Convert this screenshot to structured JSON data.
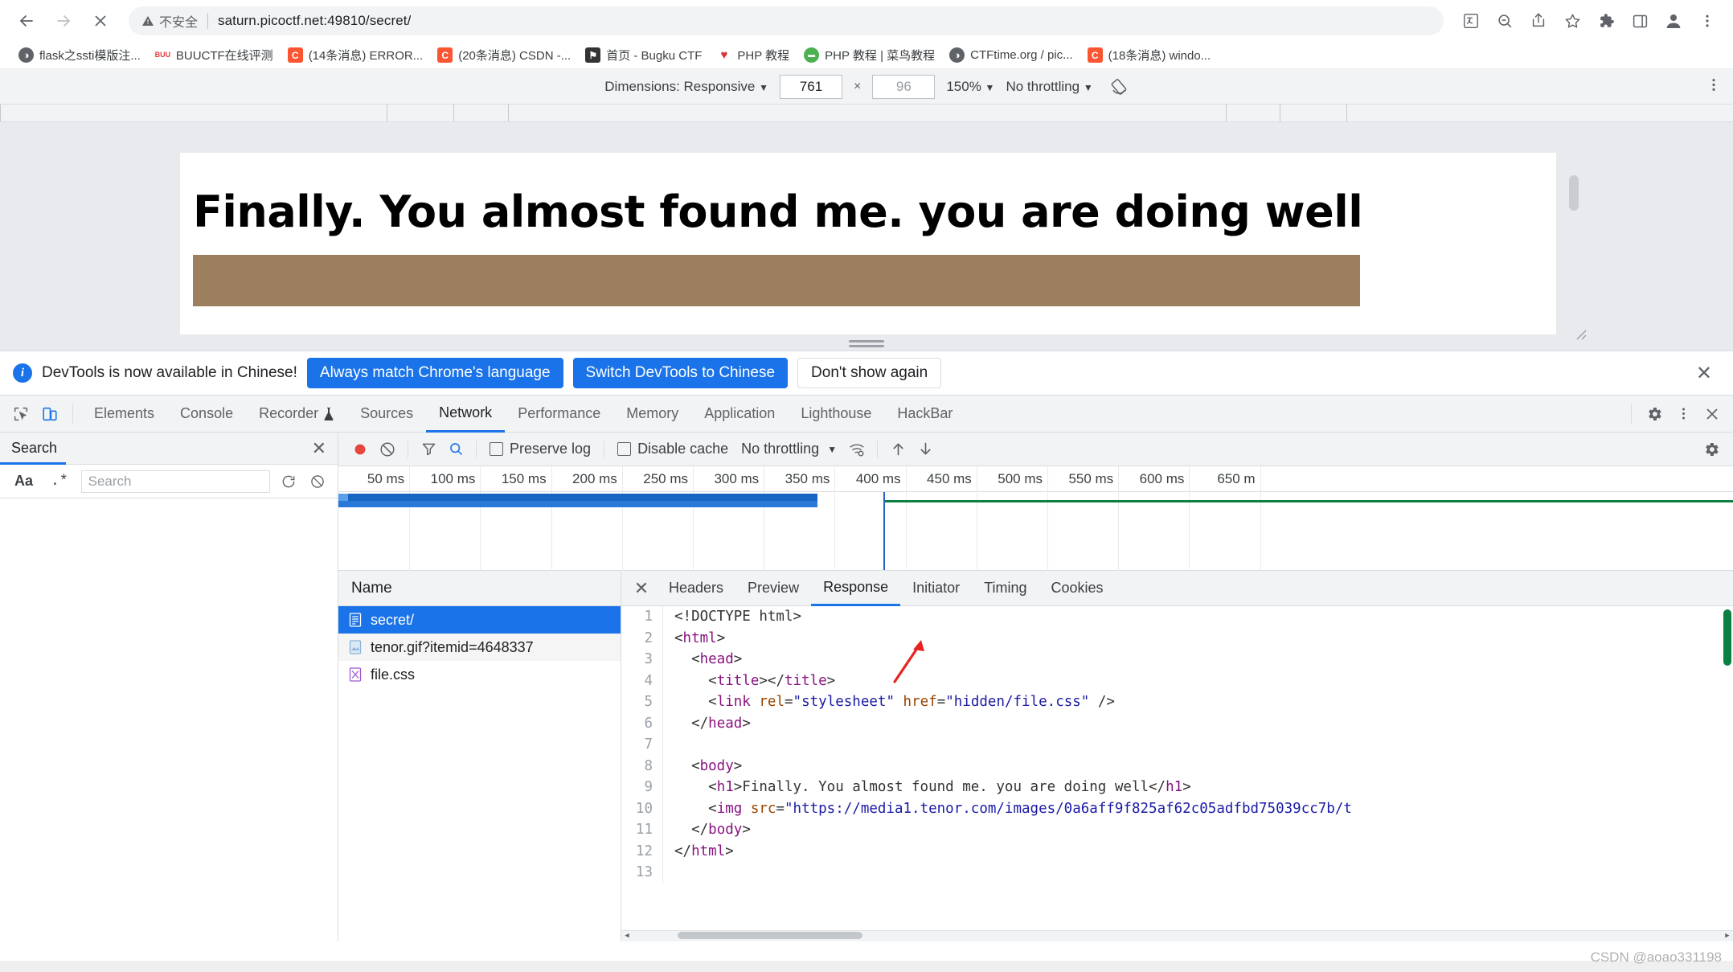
{
  "browser": {
    "nav": {
      "back": "back-arrow",
      "forward": "forward-arrow",
      "stop": "stop-x"
    },
    "omnibox": {
      "security_label": "不安全",
      "url_host": "saturn.picoctf.net:49810",
      "url_path": "/secret/",
      "full_url": "saturn.picoctf.net:49810/secret/"
    },
    "toolbar_icons": [
      "translate-icon",
      "zoom-icon",
      "share-icon",
      "bookmark-star-icon",
      "extensions-puzzle-icon",
      "side-panel-icon",
      "profile-avatar-icon",
      "chrome-menu-icon"
    ],
    "bookmarks": [
      {
        "label": "flask之ssti模版注...",
        "icon": "globe-icon",
        "color": "#5f6368"
      },
      {
        "label": "BUUCTF在线评测",
        "icon": "buu-icon",
        "color": "#e23a3a"
      },
      {
        "label": "(14条消息) ERROR...",
        "icon": "csdn-icon",
        "color": "#fc5531"
      },
      {
        "label": "(20条消息) CSDN -...",
        "icon": "csdn-icon",
        "color": "#fc5531"
      },
      {
        "label": "首页 - Bugku CTF",
        "icon": "flag-icon",
        "color": "#333333"
      },
      {
        "label": "PHP 教程",
        "icon": "php-heart-icon",
        "color": "#d8323a"
      },
      {
        "label": "PHP 教程 | 菜鸟教程",
        "icon": "runoob-icon",
        "color": "#4caf50"
      },
      {
        "label": "CTFtime.org / pic...",
        "icon": "globe-icon",
        "color": "#5f6368"
      },
      {
        "label": "(18条消息) windo...",
        "icon": "csdn-icon",
        "color": "#fc5531"
      }
    ]
  },
  "device_toolbar": {
    "dimensions_label": "Dimensions: Responsive",
    "width_value": "761",
    "multiply": "×",
    "height_value": "96",
    "zoom_value": "150%",
    "throttling_value": "No throttling",
    "rotate_icon": "rotate-device-icon",
    "more_icon": "more-vertical-icon"
  },
  "page_preview": {
    "heading": "Finally. You almost found me. you are doing well",
    "image_placeholder_color": "#9c7f5f"
  },
  "devtools_banner": {
    "message": "DevTools is now available in Chinese!",
    "primary_button": "Always match Chrome's language",
    "secondary_button": "Switch DevTools to Chinese",
    "dismiss_button": "Don't show again",
    "close_icon": "close-icon"
  },
  "devtools": {
    "left_icons": [
      "inspect-element-icon",
      "device-toolbar-icon"
    ],
    "tabs": [
      {
        "label": "Elements",
        "active": false
      },
      {
        "label": "Console",
        "active": false
      },
      {
        "label": "Recorder",
        "active": false,
        "badge": "flask-icon"
      },
      {
        "label": "Sources",
        "active": false
      },
      {
        "label": "Network",
        "active": true
      },
      {
        "label": "Performance",
        "active": false
      },
      {
        "label": "Memory",
        "active": false
      },
      {
        "label": "Application",
        "active": false
      },
      {
        "label": "Lighthouse",
        "active": false
      },
      {
        "label": "HackBar",
        "active": false
      }
    ],
    "right_icons": [
      "settings-gear-icon",
      "more-vertical-icon",
      "close-icon"
    ]
  },
  "search_pane": {
    "title": "Search",
    "close_icon": "close-icon",
    "match_case_label": "Aa",
    "regex_label": ".*",
    "input_placeholder": "Search",
    "refresh_icon": "refresh-icon",
    "clear_icon": "clear-icon"
  },
  "network_toolbar": {
    "record_icon": "record-circle-icon",
    "clear_icon": "clear-circle-icon",
    "filter_icon": "filter-funnel-icon",
    "search_icon": "search-icon",
    "preserve_log_label": "Preserve log",
    "disable_cache_label": "Disable cache",
    "throttling_value": "No throttling",
    "wifi_icon": "network-conditions-icon",
    "import_icon": "upload-arrow-icon",
    "export_icon": "download-arrow-icon",
    "settings_icon": "settings-gear-icon"
  },
  "timeline": {
    "ticks": [
      "50 ms",
      "100 ms",
      "150 ms",
      "200 ms",
      "250 ms",
      "300 ms",
      "350 ms",
      "400 ms",
      "450 ms",
      "500 ms",
      "550 ms",
      "600 ms",
      "650 m"
    ]
  },
  "request_list": {
    "header": "Name",
    "rows": [
      {
        "name": "secret/",
        "icon": "document-icon",
        "selected": true
      },
      {
        "name": "tenor.gif?itemid=4648337",
        "icon": "image-icon",
        "selected": false
      },
      {
        "name": "file.css",
        "icon": "stylesheet-icon",
        "selected": false
      }
    ]
  },
  "detail_pane": {
    "close_icon": "close-icon",
    "tabs": [
      {
        "label": "Headers",
        "active": false
      },
      {
        "label": "Preview",
        "active": false
      },
      {
        "label": "Response",
        "active": true
      },
      {
        "label": "Initiator",
        "active": false
      },
      {
        "label": "Timing",
        "active": false
      },
      {
        "label": "Cookies",
        "active": false
      }
    ],
    "code_lines": [
      {
        "n": "1",
        "segments": [
          {
            "t": "<!DOCTYPE html>",
            "c": "ct"
          }
        ]
      },
      {
        "n": "2",
        "segments": [
          {
            "t": "<",
            "c": "ct"
          },
          {
            "t": "html",
            "c": "tg"
          },
          {
            "t": ">",
            "c": "ct"
          }
        ]
      },
      {
        "n": "3",
        "segments": [
          {
            "t": "  <",
            "c": "ct"
          },
          {
            "t": "head",
            "c": "tg"
          },
          {
            "t": ">",
            "c": "ct"
          }
        ]
      },
      {
        "n": "4",
        "segments": [
          {
            "t": "    <",
            "c": "ct"
          },
          {
            "t": "title",
            "c": "tg"
          },
          {
            "t": "></",
            "c": "ct"
          },
          {
            "t": "title",
            "c": "tg"
          },
          {
            "t": ">",
            "c": "ct"
          }
        ]
      },
      {
        "n": "5",
        "segments": [
          {
            "t": "    <",
            "c": "ct"
          },
          {
            "t": "link",
            "c": "tg"
          },
          {
            "t": " ",
            "c": "ct"
          },
          {
            "t": "rel",
            "c": "at"
          },
          {
            "t": "=",
            "c": "ct"
          },
          {
            "t": "\"stylesheet\"",
            "c": "vl"
          },
          {
            "t": " ",
            "c": "ct"
          },
          {
            "t": "href",
            "c": "at"
          },
          {
            "t": "=",
            "c": "ct"
          },
          {
            "t": "\"hidden/file.css\"",
            "c": "vl"
          },
          {
            "t": " />",
            "c": "ct"
          }
        ]
      },
      {
        "n": "6",
        "segments": [
          {
            "t": "  </",
            "c": "ct"
          },
          {
            "t": "head",
            "c": "tg"
          },
          {
            "t": ">",
            "c": "ct"
          }
        ]
      },
      {
        "n": "7",
        "segments": [
          {
            "t": "",
            "c": "ct"
          }
        ]
      },
      {
        "n": "8",
        "segments": [
          {
            "t": "  <",
            "c": "ct"
          },
          {
            "t": "body",
            "c": "tg"
          },
          {
            "t": ">",
            "c": "ct"
          }
        ]
      },
      {
        "n": "9",
        "segments": [
          {
            "t": "    <",
            "c": "ct"
          },
          {
            "t": "h1",
            "c": "tg"
          },
          {
            "t": ">Finally. You almost found me. you are doing well</",
            "c": "ct"
          },
          {
            "t": "h1",
            "c": "tg"
          },
          {
            "t": ">",
            "c": "ct"
          }
        ]
      },
      {
        "n": "10",
        "segments": [
          {
            "t": "    <",
            "c": "ct"
          },
          {
            "t": "img",
            "c": "tg"
          },
          {
            "t": " ",
            "c": "ct"
          },
          {
            "t": "src",
            "c": "at"
          },
          {
            "t": "=",
            "c": "ct"
          },
          {
            "t": "\"https://media1.tenor.com/images/0a6aff9f825af62c05adfbd75039cc7b/t",
            "c": "vl"
          }
        ]
      },
      {
        "n": "11",
        "segments": [
          {
            "t": "  </",
            "c": "ct"
          },
          {
            "t": "body",
            "c": "tg"
          },
          {
            "t": ">",
            "c": "ct"
          }
        ]
      },
      {
        "n": "12",
        "segments": [
          {
            "t": "</",
            "c": "ct"
          },
          {
            "t": "html",
            "c": "tg"
          },
          {
            "t": ">",
            "c": "ct"
          }
        ]
      },
      {
        "n": "13",
        "segments": [
          {
            "t": "",
            "c": "ct"
          }
        ]
      }
    ]
  },
  "annotation": {
    "arrow": "red-arrow-pointing-to-href",
    "arrow_color": "#e8231f"
  },
  "watermark": "CSDN @aoao331198"
}
